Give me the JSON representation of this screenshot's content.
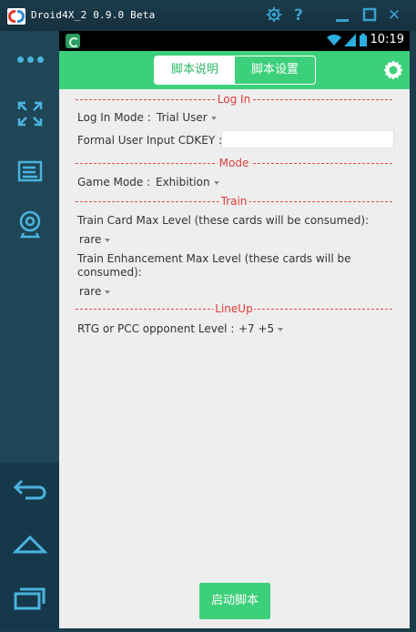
{
  "window": {
    "title": "Droid4X_2 0.9.0 Beta"
  },
  "title_controls": {
    "settings_icon": "gear-icon",
    "help_label": "?",
    "minimize_icon": "minimize-icon",
    "maximize_icon": "maximize-icon",
    "close_label": "✕"
  },
  "sidebar": {
    "items": [
      "more-icon",
      "fullscreen-icon",
      "keyboard-icon",
      "camera-icon",
      "back-icon",
      "home-icon",
      "recents-icon"
    ]
  },
  "status_bar": {
    "time": "10:19"
  },
  "app": {
    "tabs": [
      {
        "label": "脚本说明",
        "active": false
      },
      {
        "label": "脚本设置",
        "active": true
      }
    ],
    "sections": {
      "login": "Log In",
      "mode": "Mode",
      "train": "Train",
      "lineup": "LineUp"
    },
    "fields": {
      "login_mode_label": "Log In Mode :",
      "login_mode_value": "Trial User",
      "cdkey_label": "Formal User Input CDKEY :",
      "cdkey_value": "",
      "game_mode_label": "Game Mode :",
      "game_mode_value": "Exhibition",
      "train_card_label": "Train Card Max Level (these cards will be consumed):",
      "train_card_value": "rare",
      "train_enh_label_line1": "Train Enhancement Max Level (these cards will be",
      "train_enh_label_line2": "consumed):",
      "train_enh_value": "rare",
      "rtg_label": "RTG or PCC opponent Level :",
      "rtg_value": "+7 +5"
    },
    "start_button": "启动脚本"
  },
  "colors": {
    "accent_green": "#3dd07a",
    "separator_red": "#e03c3c",
    "emulator_blue": "#4bb3df",
    "sidebar_bg": "#1f4656"
  }
}
